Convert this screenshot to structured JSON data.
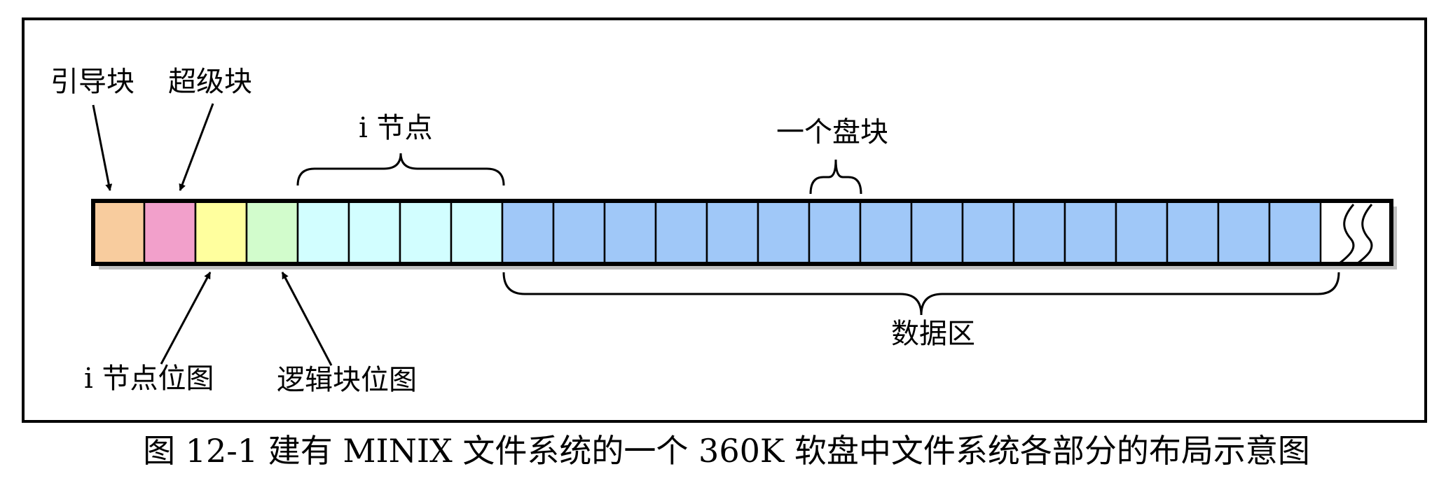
{
  "labels": {
    "boot_block": "引导块",
    "super_block": "超级块",
    "inode_bitmap": "i 节点位图",
    "zone_bitmap": "逻辑块位图",
    "inodes": "i 节点",
    "one_block": "一个盘块",
    "data_area": "数据区"
  },
  "caption": "图 12-1 建有 MINIX 文件系统的一个 360K 软盘中文件系统各部分的布局示意图",
  "colors": {
    "boot_block": "#f8cc9e",
    "super_block": "#f2a0cb",
    "inode_bitmap": "#ffff9e",
    "zone_bitmap": "#d2fccc",
    "inodes": "#d2feff",
    "data": "#a0c8f8",
    "border": "#000000",
    "shadow": "#c0c0c0"
  },
  "block_counts": {
    "boot": 1,
    "super": 1,
    "inode_bitmap": 1,
    "zone_bitmap": 1,
    "inodes": 4,
    "data": 16
  }
}
